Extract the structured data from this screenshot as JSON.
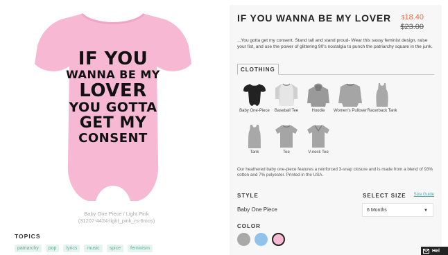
{
  "product": {
    "title": "IF YOU WANNA BE MY LOVER",
    "price_current": "18.40",
    "currency": "$",
    "price_original": "$23.00",
    "description": "...You gotta get my consent. Stand tall and stand proud- Wear this sassy feminist design, raise your fist, and use the power of glittering 90's nostalgia to punch the patriarchy square in the junk.",
    "image_text": [
      "IF YOU",
      "WANNA BE MY",
      "LOVER",
      "YOU GOTTA",
      "GET MY",
      "CONSENT"
    ],
    "caption_line1": "Baby One Piece / Light Pink",
    "caption_line2": "(31207-4424-light_pink_rs-6mos)",
    "onesie_color": "#f6b8d2"
  },
  "topics": {
    "title": "TOPICS",
    "tags": [
      "patriarchy",
      "pop",
      "lyrics",
      "music",
      "spice",
      "feminism"
    ]
  },
  "clothing": {
    "tab_label": "CLOTHING",
    "styles": [
      {
        "label": "Baby One-Piece",
        "icon": "baby-onepiece-icon"
      },
      {
        "label": "Baseball Tee",
        "icon": "baseball-tee-icon"
      },
      {
        "label": "Hoodie",
        "icon": "hoodie-icon"
      },
      {
        "label": "Women's Pullover",
        "icon": "pullover-icon"
      },
      {
        "label": "Racerback Tank",
        "icon": "racerback-icon"
      },
      {
        "label": "Tank",
        "icon": "tank-icon"
      },
      {
        "label": "Tee",
        "icon": "tee-icon"
      },
      {
        "label": "V-neck Tee",
        "icon": "vneck-icon"
      }
    ],
    "info": "Our heathered baby one-piece features a reinforced 3-snap closure and is made from a blend of 93% cotton and 7% polyester. Printed in the USA."
  },
  "options": {
    "style_label": "STYLE",
    "style_value": "Baby One Piece",
    "size_label": "SELECT SIZE",
    "size_guide": "Size Guide",
    "size_value": "6 Months",
    "color_label": "COLOR",
    "colors": [
      "#a9a9a9",
      "#8fc3ec",
      "#f6b8d2"
    ]
  },
  "help": {
    "label": "Hel"
  }
}
